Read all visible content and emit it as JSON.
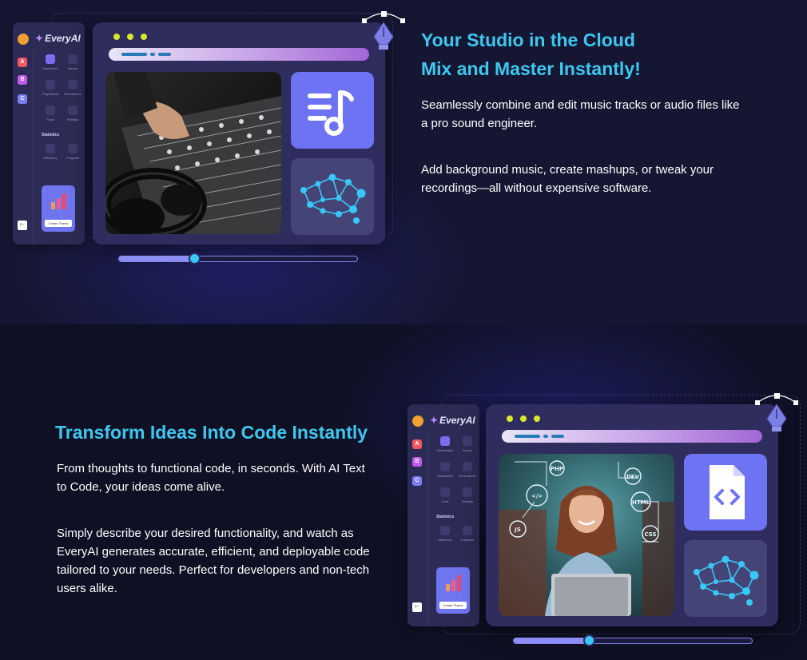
{
  "section1": {
    "heading_line1": "Your Studio in the Cloud",
    "heading_line2": "Mix and Master Instantly!",
    "para1": "Seamlessly combine and edit music tracks or audio files like a pro sound engineer.",
    "para2": "Add background music, create mashups, or tweak your recordings—all without expensive software."
  },
  "section2": {
    "heading": "Transform Ideas Into Code Instantly",
    "para1": "From thoughts to functional code, in seconds. With AI Text to Code, your ideas come alive.",
    "para2": "Simply describe your desired functionality, and watch as EveryAI generates accurate, efficient, and deployable code tailored to your needs. Perfect for developers and non-tech users alike."
  },
  "mock_app": {
    "brand": "EveryAI",
    "rail_buttons": [
      "A",
      "B",
      "C"
    ],
    "nav": [
      "Dashboard",
      "Source",
      "Playboards",
      "Generations",
      "Tools",
      "Settings"
    ],
    "stats_label": "Statistics",
    "stats_items": [
      "Efficiency",
      "Progress"
    ],
    "promo_cta": "Create Teams",
    "exit_glyph": "⊢",
    "code_tags": [
      "PHP",
      "DEV",
      "HTML",
      "JS",
      "CSS",
      "</>"
    ]
  },
  "colors": {
    "accent_cyan": "#3ec8f0",
    "tile_blue": "#6d73f2",
    "window_bg": "#2f2d5e",
    "traffic_dot": "#d7e82f"
  },
  "icons": {
    "music_tile": "music-note-list-icon",
    "code_tile": "code-file-icon",
    "network_tile": "neural-network-icon",
    "pen_tool": "pen-tool-icon"
  },
  "sliders": {
    "studio_progress": 0.32,
    "code_progress": 0.32
  }
}
